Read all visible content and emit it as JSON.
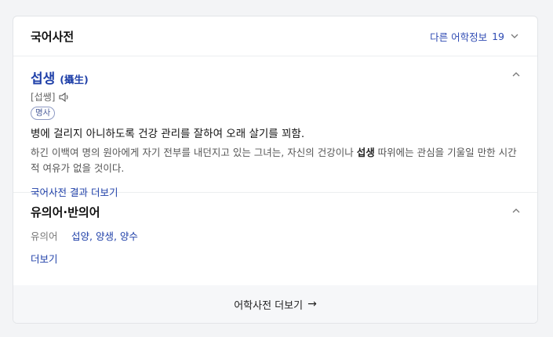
{
  "header": {
    "title": "국어사전",
    "more_label": "다른 어학정보",
    "more_count": "19"
  },
  "entry": {
    "word": "섭생",
    "hanja": "(攝生)",
    "pronunciation": "[섭쌩]",
    "pos": "명사",
    "definition": "병에 걸리지 아니하도록 건강 관리를 잘하여 오래 살기를 꾀함.",
    "example_before": "하긴 이백여 명의 원아에게 자기 전부를 내던지고 있는 그녀는, 자신의 건강이나 ",
    "example_bold": "섭생",
    "example_after": " 따위에는 관심을 기울일 만한 시간적 여유가 없을 것이다.",
    "more_link": "국어사전 결과 더보기"
  },
  "synonyms": {
    "title": "유의어·반의어",
    "label": "유의어",
    "values": "섭양, 양생, 양수",
    "more_link": "더보기"
  },
  "footer": {
    "label": "어학사전 더보기",
    "arrow": "→"
  }
}
